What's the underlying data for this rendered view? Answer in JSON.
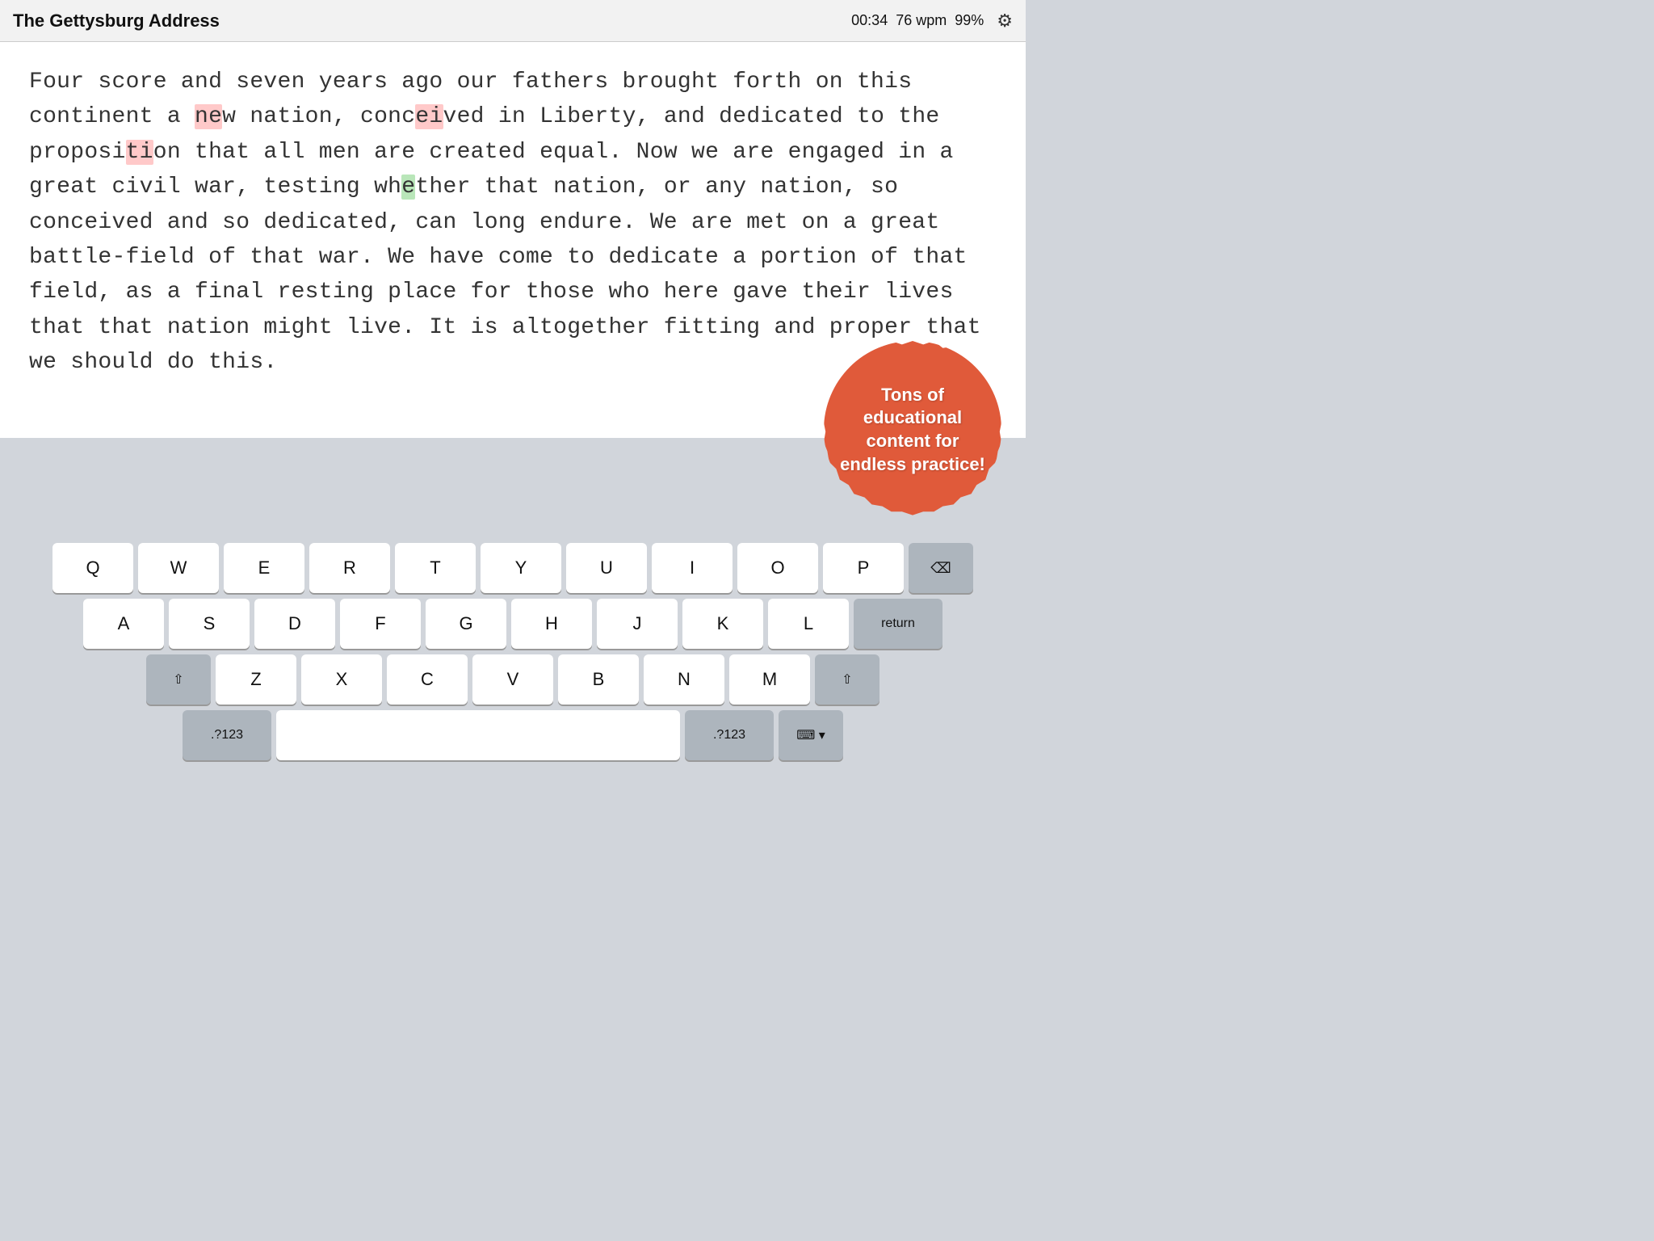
{
  "header": {
    "title": "The Gettysburg Address",
    "timer": "00:34",
    "wpm": "76 wpm",
    "accuracy": "99%"
  },
  "text": {
    "content": "Four score and seven years ago our fathers brought forth on this continent a new nation, conceived in Liberty, and dedicated to the proposition that all men are created equal. Now we are engaged in a great civil war, testing whether that nation, or any nation, so conceived and so dedicated, can long endure. We are met on a great battle-field of that war. We have come to dedicate a portion of that field, as a final resting place for those who here gave their lives that that nation might live. It is altogether fitting and proper that we should do this."
  },
  "promo": {
    "text": "Tons of educational content for endless practice!"
  },
  "keyboard": {
    "row1": [
      "Q",
      "W",
      "E",
      "R",
      "T",
      "Y",
      "U",
      "I",
      "O",
      "P"
    ],
    "row2": [
      "A",
      "S",
      "D",
      "F",
      "G",
      "H",
      "J",
      "K",
      "L"
    ],
    "row3": [
      "Z",
      "X",
      "C",
      "V",
      "B",
      "N",
      "M"
    ],
    "special": {
      "backspace": "⌫",
      "shift": "⇧",
      "return": "return",
      "numbers": ".?123",
      "keyboard_hide": "⌨"
    }
  }
}
